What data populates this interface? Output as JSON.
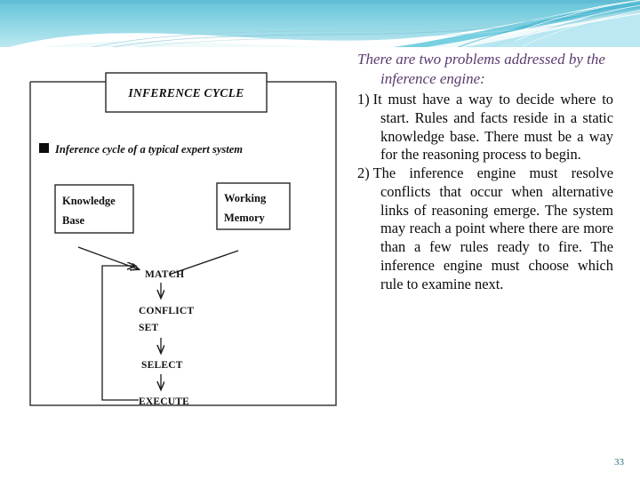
{
  "slide": {
    "page_number": "33",
    "background_color": "#ffffff",
    "accent_color": "#5bc8dc",
    "heading_color": "#5b3a6e",
    "page_number_color": "#2f6f7d"
  },
  "header": {
    "decor_name": "teal-wave-banner",
    "colors": {
      "band_top": "#7fd0e0",
      "band_bottom": "#bfe8f0",
      "ribbon_dark": "#2aa8c4",
      "ribbon_mid": "#5bc8dc",
      "ribbon_light": "#a9e2ee",
      "ribbon_pale": "#d9f2f7"
    }
  },
  "diagram": {
    "title_box": {
      "label": "INFERENCE CYCLE"
    },
    "bullet": {
      "marker": "square-bullet",
      "text": "Inference cycle of a typical expert system"
    },
    "source_boxes": [
      {
        "id": "knowledge-base",
        "lines": [
          "Knowledge",
          "Base"
        ]
      },
      {
        "id": "working-memory",
        "lines": [
          "Working",
          "Memory"
        ]
      }
    ],
    "cycle_steps": [
      {
        "id": "match",
        "lines": [
          "MATCH"
        ]
      },
      {
        "id": "conflict-set",
        "lines": [
          "CONFLICT",
          "SET"
        ]
      },
      {
        "id": "select",
        "lines": [
          "SELECT"
        ]
      },
      {
        "id": "execute",
        "lines": [
          "EXECUTE"
        ]
      }
    ],
    "connections": [
      {
        "from": "knowledge-base",
        "to": "match",
        "style": "arrow"
      },
      {
        "from": "working-memory",
        "to": "match",
        "style": "arrow"
      },
      {
        "from": "match",
        "to": "conflict-set",
        "style": "down-arrow"
      },
      {
        "from": "conflict-set",
        "to": "select",
        "style": "down-arrow"
      },
      {
        "from": "select",
        "to": "execute",
        "style": "down-arrow"
      },
      {
        "from": "execute",
        "to": "match",
        "style": "feedback-loop"
      }
    ]
  },
  "text_column": {
    "lead": "There are two problems addressed by the inference engine:",
    "items": [
      {
        "marker": "1)",
        "text": "It must have a way to decide where to start. Rules and facts reside in a static knowledge base. There must be a way for the reasoning process to begin."
      },
      {
        "marker": "2)",
        "text": "The inference engine must resolve conflicts that occur when alternative links of reasoning emerge. The system may reach a point where there are more than a few rules ready to fire. The inference engine must choose which rule to examine next."
      }
    ]
  }
}
